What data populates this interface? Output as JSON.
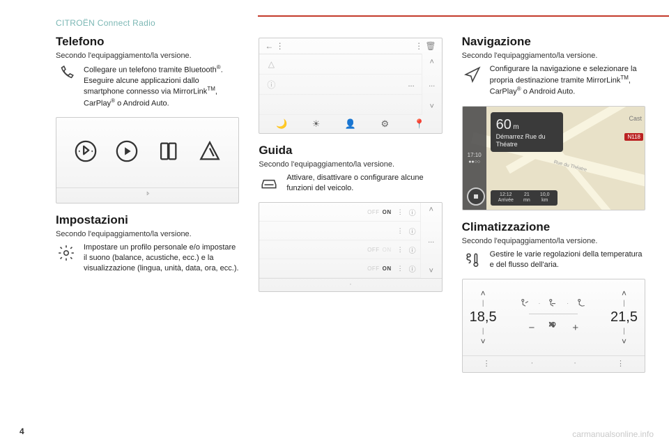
{
  "header": {
    "brand": "CITROËN Connect Radio"
  },
  "page_number": "4",
  "watermark": "carmanualsonline.info",
  "phone": {
    "title": "Telefono",
    "subnote": "Secondo l'equipaggiamento/la versione.",
    "desc": "Collegare un telefono tramite Bluetooth®.\nEseguire alcune applicazioni dallo smartphone connesso via MirrorLinkTM, CarPlay® o Android Auto.",
    "icons": [
      "bluetooth-circle",
      "play-circle",
      "mirrorlink",
      "androidauto-arrow"
    ],
    "footer_icon": "bt-small"
  },
  "settings": {
    "title": "Impostazioni",
    "subnote": "Secondo l'equipaggiamento/la versione.",
    "desc": "Impostare un profilo personale e/o impostare il suono (balance, acustiche, ecc.) e la visualizzazione (lingua, unità, data, ora, ecc.).",
    "panel": {
      "topbar_left": "← ⋮",
      "topbar_right": "⋮ 🗑",
      "rows": [
        {
          "icon": "△",
          "text": ""
        },
        {
          "icon": "ⓘ",
          "text": "..."
        },
        {
          "icon": "",
          "text": ""
        }
      ],
      "bottom_icons": [
        "🌙",
        "☀",
        "👤",
        "⚙",
        "📍"
      ],
      "side": [
        "˄",
        "...",
        "˅"
      ]
    }
  },
  "guida": {
    "title": "Guida",
    "subnote": "Secondo l'equipaggiamento/la versione.",
    "desc": "Attivare, disattivare o configurare alcune funzioni del veicolo.",
    "panel": {
      "rows": [
        {
          "off": "OFF",
          "on": "ON",
          "on_active": true
        },
        {
          "off": "",
          "on": "",
          "on_active": false
        },
        {
          "off": "OFF",
          "on": "ON",
          "on_active": false
        },
        {
          "off": "OFF",
          "on": "ON",
          "on_active": true
        }
      ],
      "side": [
        "˄",
        "...",
        "˅"
      ],
      "footer_dot": "·"
    }
  },
  "navigation": {
    "title": "Navigazione",
    "subnote": "Secondo l'equipaggiamento/la versione.",
    "desc": "Configurare la navigazione e selezionare la propria destinazione tramite MirrorLinkTM, CarPlay® o Android Auto.",
    "panel": {
      "side_time": "17:10",
      "instruction_val": "60",
      "instruction_unit": "m",
      "instruction_text": "Démarrez Rue du Théatre",
      "eta_time": "12:12",
      "eta_time_label": "Arrivée",
      "eta_min": "21",
      "eta_min_label": "mn",
      "eta_dist": "10,0",
      "eta_dist_label": "km",
      "road_badge": "N118",
      "map_label_cast": "Cast",
      "map_label_road": "Rue du Théatre"
    }
  },
  "climate": {
    "title": "Climatizzazione",
    "subnote": "Secondo l'equipaggiamento/la versione.",
    "desc": "Gestire le varie regolazioni della temperatura e del flusso dell'aria.",
    "panel": {
      "left_temp": "18,5",
      "right_temp": "21,5",
      "footer_dots": [
        "⋮",
        "·",
        "·",
        "⋮"
      ]
    }
  }
}
